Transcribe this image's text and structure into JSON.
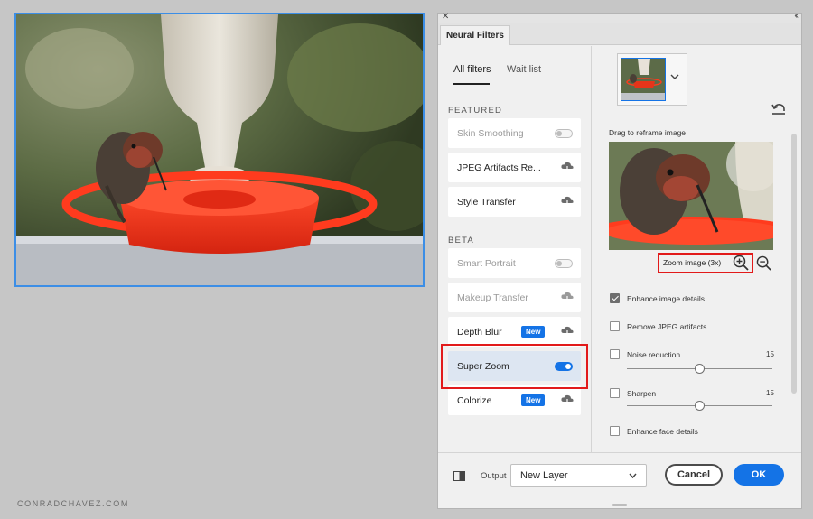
{
  "watermark": "CONRADCHAVEZ.COM",
  "panel": {
    "title_tab": "Neural Filters",
    "tabs": [
      {
        "label": "All filters",
        "active": true
      },
      {
        "label": "Wait list",
        "active": false
      }
    ],
    "sections": {
      "featured": "FEATURED",
      "beta": "BETA"
    },
    "filters": [
      {
        "label": "Skin Smoothing",
        "state": "toggle-off",
        "disabled": true
      },
      {
        "label": "JPEG Artifacts Re...",
        "state": "download"
      },
      {
        "label": "Style Transfer",
        "state": "download"
      },
      {
        "label": "Smart Portrait",
        "state": "toggle-off",
        "disabled": true
      },
      {
        "label": "Makeup Transfer",
        "state": "download",
        "disabled": true
      },
      {
        "label": "Depth Blur",
        "state": "download",
        "badge": "New"
      },
      {
        "label": "Super Zoom",
        "state": "toggle-on",
        "selected": true
      },
      {
        "label": "Colorize",
        "state": "download",
        "badge": "New"
      }
    ]
  },
  "settings": {
    "reframe_label": "Drag to reframe image",
    "zoom_label": "Zoom image (3x)",
    "options": [
      {
        "label": "Enhance image details",
        "checked": true
      },
      {
        "label": "Remove JPEG artifacts",
        "checked": false
      },
      {
        "label": "Noise reduction",
        "checked": false,
        "value": "15",
        "slider": 0.5
      },
      {
        "label": "Sharpen",
        "checked": false,
        "value": "15",
        "slider": 0.5
      },
      {
        "label": "Enhance face details",
        "checked": false
      }
    ]
  },
  "footer": {
    "output_label": "Output",
    "output_value": "New Layer",
    "cancel_label": "Cancel",
    "ok_label": "OK"
  },
  "colors": {
    "accent": "#1473e6",
    "highlight": "#e21a1a",
    "selection": "#3c8ee6"
  },
  "icons": [
    "close-icon",
    "collapse-icon",
    "cloud-download-icon",
    "chevron-down-icon",
    "reset-icon",
    "zoom-in-icon",
    "zoom-out-icon",
    "compare-icon"
  ]
}
